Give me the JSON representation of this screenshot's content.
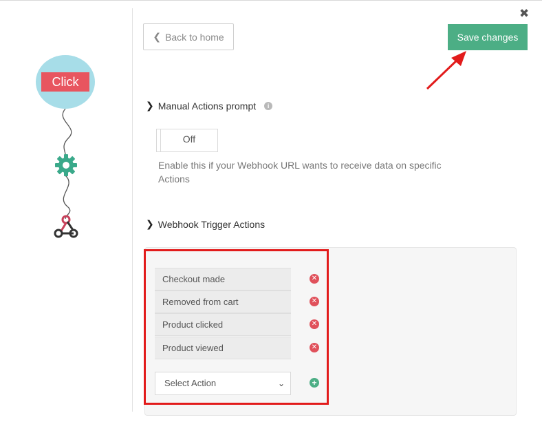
{
  "flow": {
    "click_label": "Click",
    "steps": [
      "gear-icon",
      "webhook-icon"
    ]
  },
  "header": {
    "back_label": "Back to home",
    "save_label": "Save changes",
    "close_icon": "close-icon"
  },
  "manual_actions": {
    "title": "Manual Actions prompt",
    "toggle_value": "Off",
    "help_text": "Enable this if your Webhook URL wants to receive data on specific Actions"
  },
  "webhook_trigger": {
    "title": "Webhook Trigger Actions",
    "actions": [
      {
        "label": "Checkout made"
      },
      {
        "label": "Removed from cart"
      },
      {
        "label": "Product clicked"
      },
      {
        "label": "Product viewed"
      }
    ],
    "select_value": "Select Action"
  },
  "colors": {
    "accent_green": "#4cae85",
    "remove_red": "#e0515b",
    "highlight_red": "#e21b1b",
    "click_circle": "#a7dde8",
    "click_label_bg": "#e8555f"
  }
}
